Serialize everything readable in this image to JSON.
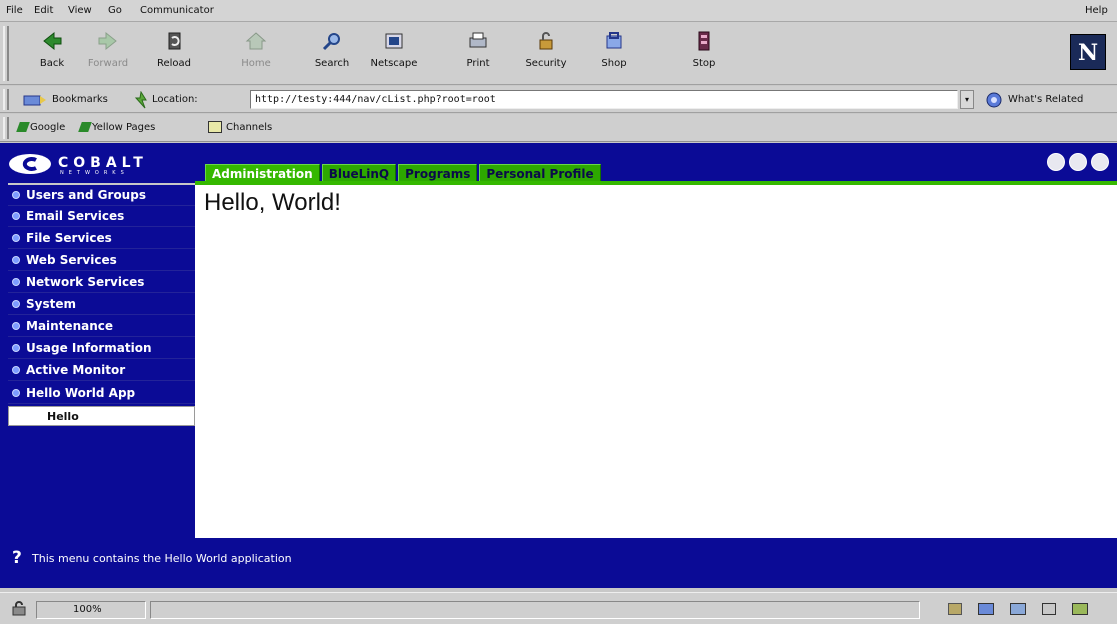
{
  "menu": {
    "items": [
      "File",
      "Edit",
      "View",
      "Go",
      "Communicator"
    ],
    "help": "Help"
  },
  "toolbar": {
    "buttons": [
      {
        "label": "Back",
        "icon": "back-arrow-icon",
        "enabled": true
      },
      {
        "label": "Forward",
        "icon": "forward-arrow-icon",
        "enabled": false
      },
      {
        "label": "Reload",
        "icon": "reload-icon",
        "enabled": true
      },
      {
        "label": "Home",
        "icon": "home-icon",
        "enabled": false
      },
      {
        "label": "Search",
        "icon": "search-icon",
        "enabled": true
      },
      {
        "label": "Netscape",
        "icon": "netscape-icon",
        "enabled": true
      },
      {
        "label": "Print",
        "icon": "print-icon",
        "enabled": true
      },
      {
        "label": "Security",
        "icon": "lock-icon",
        "enabled": true
      },
      {
        "label": "Shop",
        "icon": "shop-icon",
        "enabled": true
      },
      {
        "label": "Stop",
        "icon": "stop-icon",
        "enabled": true
      }
    ],
    "logo_letter": "N"
  },
  "location": {
    "bookmarks_label": "Bookmarks",
    "location_label": "Location:",
    "url": "http://testy:444/nav/cList.php?root=root",
    "whats_related": "What's Related"
  },
  "personal_toolbar": {
    "items": [
      "Google",
      "Yellow Pages",
      "Channels"
    ]
  },
  "app": {
    "brand": "COBALT",
    "brand_sub": "NETWORKS",
    "tabs": [
      {
        "label": "Administration",
        "active": true
      },
      {
        "label": "BlueLinQ",
        "active": false
      },
      {
        "label": "Programs",
        "active": false
      },
      {
        "label": "Personal Profile",
        "active": false
      }
    ],
    "nav": [
      "Users and Groups",
      "Email Services",
      "File Services",
      "Web Services",
      "Network Services",
      "System",
      "Maintenance",
      "Usage Information",
      "Active Monitor",
      "Hello World App"
    ],
    "nav_sub": "Hello",
    "content_heading": "Hello, World!",
    "help_icon": "?",
    "help_text": "This menu contains the Hello World application"
  },
  "status": {
    "zoom": "100%"
  },
  "colors": {
    "app_blue": "#0b0b96",
    "tab_green": "#35b800",
    "chrome": "#cfcfcf"
  }
}
